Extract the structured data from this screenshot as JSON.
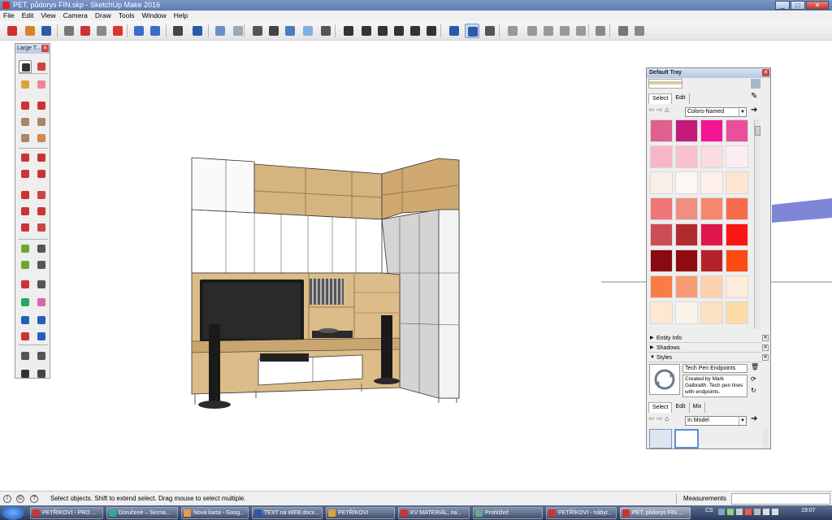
{
  "window": {
    "title": "PET, půdorys FIN.skp - SketchUp Make 2016"
  },
  "menu": [
    "File",
    "Edit",
    "View",
    "Camera",
    "Draw",
    "Tools",
    "Window",
    "Help"
  ],
  "toolbar_icons": [
    "get-started-icon",
    "open-icon",
    "save-icon",
    "cut-icon",
    "paint-icon",
    "copy-icon",
    "erase-icon",
    "undo-icon",
    "redo-icon",
    "print-icon",
    "model-info-icon",
    "xray-icon",
    "back-edges-icon",
    "wireframe-icon",
    "hidden-line-icon",
    "shaded-icon",
    "shaded-textures-icon",
    "iso-view-icon",
    "top-view-icon",
    "front-view-icon",
    "right-view-icon",
    "back-view-icon",
    "left-view-icon",
    "orbit-icon",
    "pan-icon",
    "zoom-icon",
    "sandbox-icon",
    "sandbox-contours-icon",
    "sandbox-scratch-icon",
    "sandbox-smoove-icon",
    "sandbox-stamp-icon",
    "sandbox-drape-icon",
    "warehouse-icon",
    "extension-icon",
    "share-icon"
  ],
  "tool_palette": {
    "title": "Large T...",
    "tools": [
      "select",
      "component",
      "paint-bucket",
      "eraser",
      "pencil",
      "freehand",
      "rectangle",
      "rotated-rect",
      "circle",
      "polygon",
      "arc",
      "pie",
      "2pt-arc",
      "3pt-arc",
      "move",
      "push-pull",
      "rotate",
      "follow-me",
      "scale",
      "offset",
      "tape-measure",
      "dimension",
      "protractor",
      "text",
      "axes",
      "3d-text",
      "orbit",
      "pan",
      "zoom",
      "zoom-window",
      "zoom-extents",
      "previous",
      "position-camera",
      "look-around",
      "walk",
      "section-plane"
    ]
  },
  "tray": {
    "title": "Default Tray",
    "materials": {
      "tabs": [
        "Select",
        "Edit"
      ],
      "library": "Colors-Named",
      "swatches": [
        "#e05f8e",
        "#c41a7c",
        "#f21493",
        "#ea4f9c",
        "#f7b6c8",
        "#f9c2cd",
        "#fadbe0",
        "#fbeef2",
        "#f8efe6",
        "#fbf7f2",
        "#fdf1ea",
        "#fde5cf",
        "#f07679",
        "#f08e7f",
        "#f7866f",
        "#f86a4c",
        "#cc4d55",
        "#b12b2e",
        "#e0164b",
        "#fb1414",
        "#8a0a12",
        "#8f0b0f",
        "#b62229",
        "#fb4a12",
        "#fb7b45",
        "#f79b74",
        "#fdd1b0",
        "#fdecd9",
        "#fde8d4",
        "#fbf3ea",
        "#fce2c2",
        "#fcdba6"
      ]
    },
    "panels": {
      "entity_info": "Entity Info",
      "shadows": "Shadows",
      "styles": "Styles"
    },
    "style": {
      "name": "Tech Pen Endpoints",
      "description": "Created by Mark Galbraith.  Tech pen lines with endpoints."
    },
    "style_tabs": [
      "Select",
      "Edit",
      "Mix"
    ],
    "style_library": "In Model"
  },
  "status": {
    "hint": "Select objects. Shift to extend select. Drag mouse to select multiple.",
    "measurements_label": "Measurements",
    "measurements_value": ""
  },
  "taskbar": {
    "items": [
      "PETŘÍKOVI - PRO ...",
      "Doručené – Sezna...",
      "Nová karta - Goog...",
      "TEXT na WEB.docx...",
      "PETŘÍKOVI",
      "KV MATERIÁL, na...",
      "Prohlížeč",
      "PETŘÍKOVI - nábyt...",
      "PET, půdorys FIN...."
    ],
    "lang": "CS",
    "time": "19:07"
  }
}
